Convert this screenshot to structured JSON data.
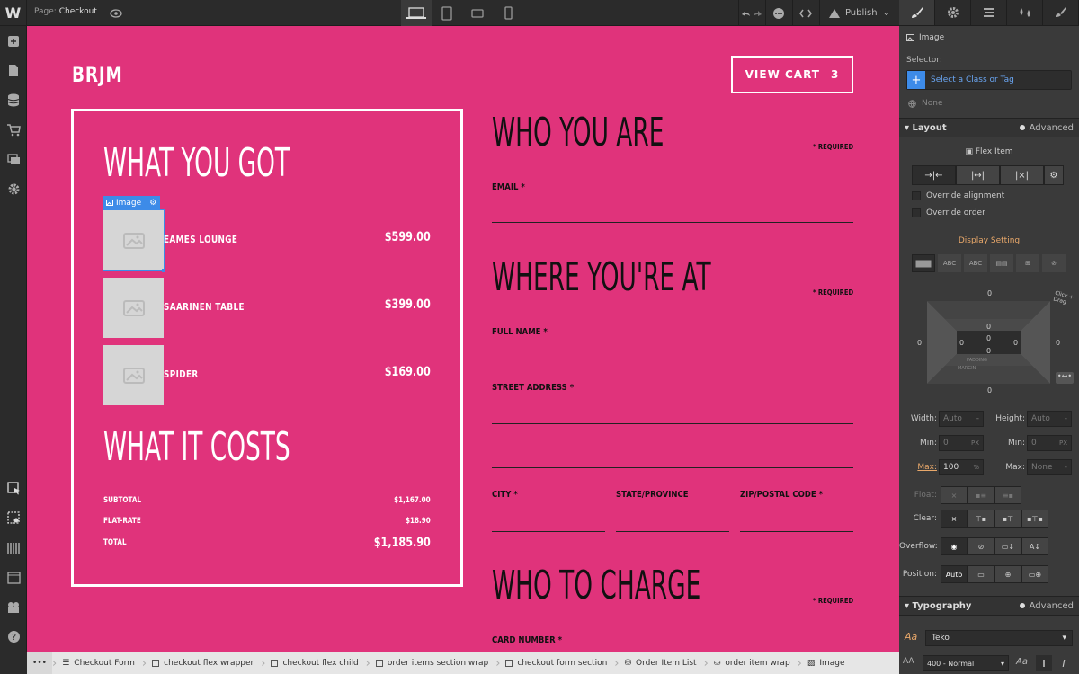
{
  "topbar": {
    "page_prefix": "Page:",
    "page_name": "Checkout",
    "publish_label": "Publish"
  },
  "canvas": {
    "brand": "BRJM",
    "cart_label": "VIEW CART",
    "cart_count": "3",
    "summary": {
      "title1": "WHAT YOU GOT",
      "selected_tag": "Image",
      "items": [
        {
          "name": "EAMES LOUNGE",
          "price": "$599.00"
        },
        {
          "name": "SAARINEN TABLE",
          "price": "$399.00"
        },
        {
          "name": "SPIDER",
          "price": "$169.00"
        }
      ],
      "title2": "WHAT IT COSTS",
      "subtotal_label": "SUBTOTAL",
      "subtotal_value": "$1,167.00",
      "flat_label": "FLAT-RATE",
      "flat_value": "$18.90",
      "total_label": "TOTAL",
      "total_value": "$1,185.90"
    },
    "form": {
      "section1": "WHO YOU ARE",
      "section2": "WHERE YOU'RE AT",
      "section3": "WHO TO CHARGE",
      "required": "* REQUIRED",
      "email": "EMAIL *",
      "full_name": "FULL NAME *",
      "street": "STREET ADDRESS *",
      "city": "CITY *",
      "state": "STATE/PROVINCE",
      "zip": "ZIP/POSTAL CODE *",
      "card": "CARD NUMBER *"
    }
  },
  "panel": {
    "element": "Image",
    "selector_label": "Selector:",
    "selector_placeholder": "Select a Class or Tag",
    "none_label": "None",
    "layout_label": "Layout",
    "advanced_label": "Advanced",
    "flex_item_label": "Flex Item",
    "override_alignment": "Override alignment",
    "override_order": "Override order",
    "display_setting": "Display Setting",
    "box": {
      "margin_top": "0",
      "margin_left": "0",
      "margin_right": "0",
      "margin_bottom": "0",
      "pad_top": "0",
      "pad_left": "0",
      "pad_right": "0",
      "pad_bottom": "0",
      "inner_top": "0",
      "inner_bottom": "0"
    },
    "margin_label": "MARGIN",
    "padding_label": "PADDING",
    "click_drag": "Click + Drag",
    "width_label": "Width:",
    "width_value": "Auto",
    "height_label": "Height:",
    "height_value": "Auto",
    "min_label": "Min:",
    "min_w": "0",
    "min_h": "0",
    "px": "PX",
    "max_label": "Max:",
    "max_w": "100",
    "max_w_unit": "%",
    "max_h": "None",
    "float_label": "Float:",
    "clear_label": "Clear:",
    "overflow_label": "Overflow:",
    "position_label": "Position:",
    "position_value": "Auto",
    "typography_label": "Typography",
    "font": "Teko",
    "weight": "400 - Normal"
  },
  "breadcrumb": [
    {
      "label": "Checkout Form",
      "icon": "form-icon"
    },
    {
      "label": "checkout flex wrapper",
      "icon": "div-icon"
    },
    {
      "label": "checkout flex child",
      "icon": "div-icon"
    },
    {
      "label": "order items section wrap",
      "icon": "div-icon"
    },
    {
      "label": "checkout form section",
      "icon": "div-icon"
    },
    {
      "label": "Order Item List",
      "icon": "collection-icon"
    },
    {
      "label": "order item wrap",
      "icon": "collection-item-icon"
    },
    {
      "label": "Image",
      "icon": "image-icon"
    }
  ]
}
